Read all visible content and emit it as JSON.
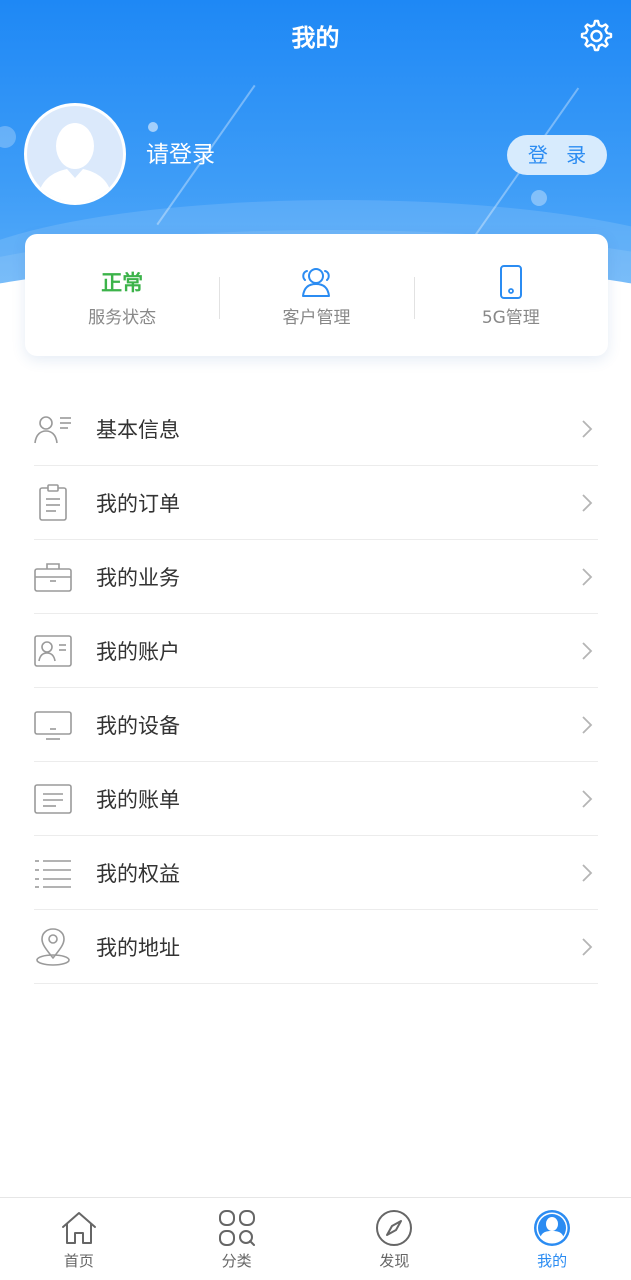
{
  "header": {
    "title": "我的",
    "login_prompt": "请登录",
    "login_button": "登 录"
  },
  "status_card": {
    "items": [
      {
        "value": "正常",
        "label": "服务状态"
      },
      {
        "icon": "people-icon",
        "label": "客户管理"
      },
      {
        "icon": "phone-icon",
        "label": "5G管理"
      }
    ]
  },
  "menu": {
    "items": [
      {
        "label": "基本信息",
        "icon": "profile-info-icon"
      },
      {
        "label": "我的订单",
        "icon": "clipboard-icon"
      },
      {
        "label": "我的业务",
        "icon": "briefcase-icon"
      },
      {
        "label": "我的账户",
        "icon": "id-card-icon"
      },
      {
        "label": "我的设备",
        "icon": "monitor-icon"
      },
      {
        "label": "我的账单",
        "icon": "bill-icon"
      },
      {
        "label": "我的权益",
        "icon": "list-icon"
      },
      {
        "label": "我的地址",
        "icon": "location-pin-icon"
      }
    ]
  },
  "tabbar": {
    "items": [
      {
        "label": "首页",
        "icon": "home-icon"
      },
      {
        "label": "分类",
        "icon": "category-icon"
      },
      {
        "label": "发现",
        "icon": "compass-icon"
      },
      {
        "label": "我的",
        "icon": "user-icon",
        "active": true
      }
    ]
  },
  "colors": {
    "primary": "#2b8cf2",
    "header_gradient_top": "#1e88f5",
    "status_ok": "#3cb34a",
    "icon_gray": "#9a9a9a"
  }
}
